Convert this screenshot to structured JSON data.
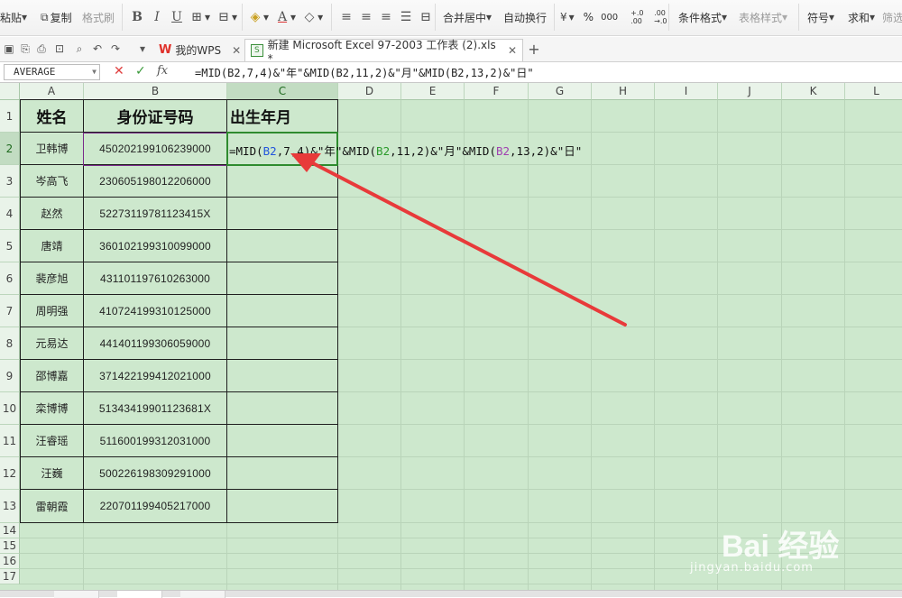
{
  "ribbon": {
    "paste": "粘贴",
    "copy": "复制",
    "format_painter": "格式刷",
    "bold": "B",
    "italic": "I",
    "underline": "U",
    "merge_center": "合并居中",
    "wrap_text": "自动换行",
    "percent": "%",
    "thousands": "000",
    "decimal_inc": "+.0\n.00",
    "decimal_dec": ".00\n→.0",
    "conditional_format": "条件格式",
    "table_style": "表格样式",
    "symbol": "符号",
    "sum": "求和",
    "filter": "筛选"
  },
  "tabs": {
    "wps_tab": "我的WPS",
    "doc_tab": "新建 Microsoft Excel 97-2003 工作表 (2).xls *",
    "new_tab": "+"
  },
  "formula_bar": {
    "name_box": "AVERAGE",
    "cancel": "✕",
    "enter": "✓",
    "fx": "fx",
    "formula": "=MID(B2,7,4)&\"年\"&MID(B2,11,2)&\"月\"&MID(B2,13,2)&\"日\""
  },
  "columns": [
    "A",
    "B",
    "C",
    "D",
    "E",
    "F",
    "G",
    "H",
    "I",
    "J",
    "K",
    "L"
  ],
  "rows": [
    "1",
    "2",
    "3",
    "4",
    "5",
    "6",
    "7",
    "8",
    "9",
    "10",
    "11",
    "12",
    "13",
    "14",
    "15",
    "16",
    "17"
  ],
  "table": {
    "headers": [
      "姓名",
      "身份证号码",
      "出生年月"
    ],
    "records": [
      {
        "name": "卫韩博",
        "id": "450202199106239000"
      },
      {
        "name": "岑高飞",
        "id": "230605198012206000"
      },
      {
        "name": "赵然",
        "id": "52273119781123415X"
      },
      {
        "name": "唐靖",
        "id": "360102199310099000"
      },
      {
        "name": "裴彦旭",
        "id": "431101197610263000"
      },
      {
        "name": "周明强",
        "id": "410724199310125000"
      },
      {
        "name": "元易达",
        "id": "441401199306059000"
      },
      {
        "name": "邵博嘉",
        "id": "371422199412021000"
      },
      {
        "name": "栾博博",
        "id": "51343419901123681X"
      },
      {
        "name": "汪睿瑶",
        "id": "511600199312031000"
      },
      {
        "name": "汪巍",
        "id": "500226198309291000"
      },
      {
        "name": "雷朝霞",
        "id": "220701199405217000"
      }
    ]
  },
  "editing_cell": {
    "p1": "=MID(",
    "r1": "B2",
    "p2": ",7,4)&\"年\"&MID(",
    "r2": "B2",
    "p3": ",11,2)&\"月\"&MID(",
    "r3": "B2",
    "p4": ",13,2)&\"日\""
  },
  "watermark": {
    "text": "Bai  经验",
    "url": "jingyan.baidu.com"
  },
  "colors": {
    "sheet_bg": "#cde8cd",
    "arrow": "#e83a3a",
    "active_border": "#2e8b2e",
    "ref_blue": "#2255dd",
    "ref_green": "#2a9a2a",
    "ref_purple": "#a040b0"
  }
}
